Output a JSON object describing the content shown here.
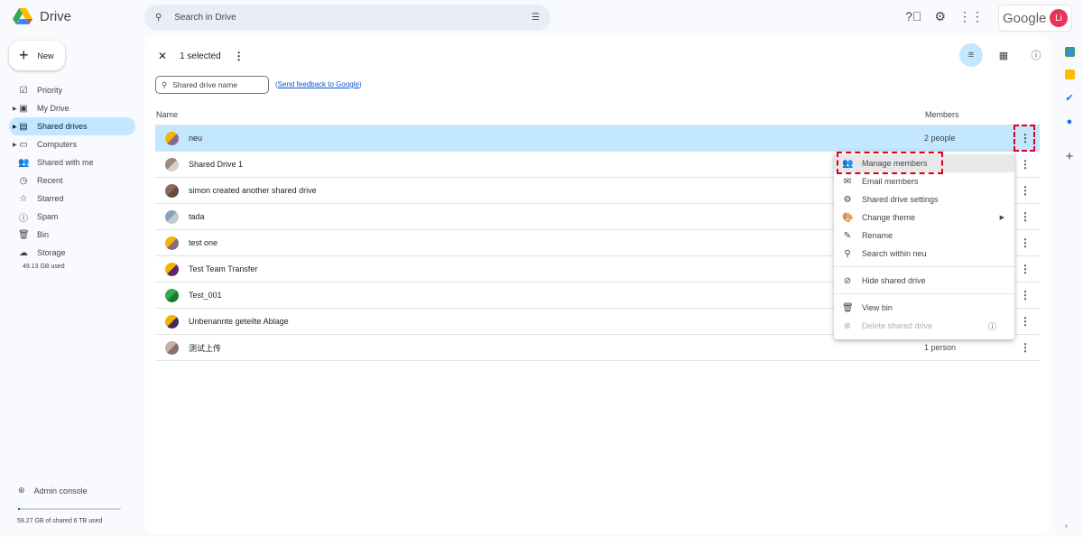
{
  "app": {
    "name": "Drive",
    "search_placeholder": "Search in Drive",
    "google": "Google",
    "avatar_letter": "Li"
  },
  "new_label": "New",
  "nav": [
    {
      "label": "Priority",
      "icon": "☑"
    },
    {
      "label": "My Drive",
      "icon": "▣"
    },
    {
      "label": "Shared drives",
      "icon": "▤"
    },
    {
      "label": "Computers",
      "icon": "▭"
    },
    {
      "label": "Shared with me",
      "icon": "👥"
    },
    {
      "label": "Recent",
      "icon": "◷"
    },
    {
      "label": "Starred",
      "icon": "☆"
    },
    {
      "label": "Spam",
      "icon": "ⓘ"
    },
    {
      "label": "Bin",
      "icon": "🗑"
    },
    {
      "label": "Storage",
      "icon": "☁"
    }
  ],
  "storage_used": "49.13 GB used",
  "admin_console": "Admin console",
  "shared_storage": {
    "text": "59.27 GB of shared 6 TB used",
    "fraction": 0.01
  },
  "selection": {
    "label": "1 selected"
  },
  "filter_placeholder": "Shared drive name",
  "feedback": {
    "open": "(",
    "link": "Send feedback to Google",
    "close": ")"
  },
  "columns": {
    "name": "Name",
    "members": "Members"
  },
  "drives": [
    {
      "name": "neu",
      "members": "2 people",
      "c1": "#f4b400",
      "c2": "#8a6a8a"
    },
    {
      "name": "Shared Drive 1",
      "members": "",
      "c1": "#9a8a80",
      "c2": "#d8d0c8"
    },
    {
      "name": "simon created another shared drive",
      "members": "",
      "c1": "#8a6a5a",
      "c2": "#6a4a3a"
    },
    {
      "name": "tada",
      "members": "",
      "c1": "#8aa0c0",
      "c2": "#c0c8d0"
    },
    {
      "name": "test one",
      "members": "",
      "c1": "#f4b400",
      "c2": "#8a6a8a"
    },
    {
      "name": "Test Team Transfer",
      "members": "",
      "c1": "#f4b400",
      "c2": "#5a2a6a"
    },
    {
      "name": "Test_001",
      "members": "",
      "c1": "#34a853",
      "c2": "#1e7a30"
    },
    {
      "name": "Unbenannte geteilte Ablage",
      "members": "",
      "c1": "#f4b400",
      "c2": "#4a2a5a"
    },
    {
      "name": "测试上传",
      "members": "1 person",
      "c1": "#c8b0a8",
      "c2": "#8a7070"
    }
  ],
  "menu": [
    {
      "label": "Manage members",
      "icon": "👥"
    },
    {
      "label": "Email members",
      "icon": "✉"
    },
    {
      "label": "Shared drive settings",
      "icon": "⚙"
    },
    {
      "label": "Change theme",
      "icon": "🎨"
    },
    {
      "label": "Rename",
      "icon": "✎"
    },
    {
      "label": "Search within neu",
      "icon": "⚲"
    },
    {
      "label": "Hide shared drive",
      "icon": "⊘"
    },
    {
      "label": "View bin",
      "icon": "🗑"
    },
    {
      "label": "Delete shared drive",
      "icon": "⊗"
    }
  ]
}
